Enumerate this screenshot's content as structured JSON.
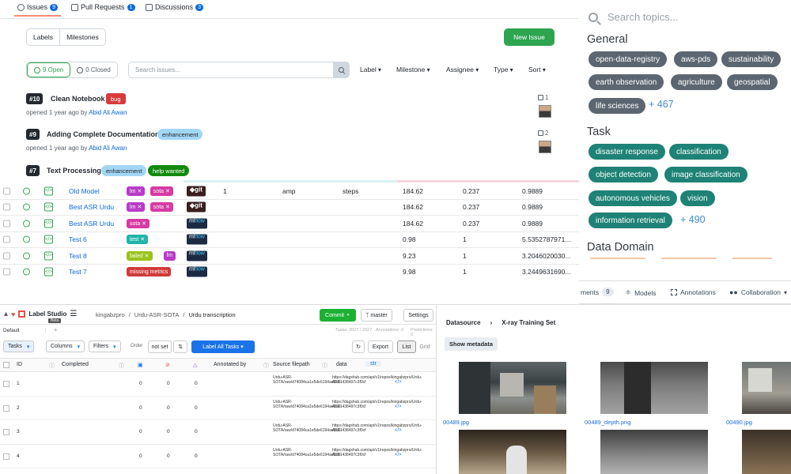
{
  "issues_panel": {
    "tabs": [
      {
        "label": "Issues",
        "count": "9"
      },
      {
        "label": "Pull Requests",
        "count": "1"
      },
      {
        "label": "Discussions",
        "count": "3"
      }
    ],
    "labels_btn": "Labels",
    "milestones_btn": "Milestones",
    "new_issue": "New Issue",
    "open_label": "9 Open",
    "closed_label": "0 Closed",
    "search_placeholder": "Search issues...",
    "filters": [
      "Label",
      "Milestone",
      "Assignee",
      "Type",
      "Sort"
    ],
    "items": [
      {
        "num": "#10",
        "title": "Clean Notebook",
        "labels": [
          {
            "text": "bug",
            "bg": "#d73a3a",
            "fg": "#ffffff"
          }
        ],
        "meta_prefix": "opened 1 year ago by",
        "author": "Abid Ali Awan",
        "comments": "1"
      },
      {
        "num": "#9",
        "title": "Adding Complete Documentation",
        "labels": [
          {
            "text": "enhancement",
            "bg": "#a2eeef",
            "fg": "#1f2328"
          }
        ],
        "meta_prefix": "opened 1 year ago by",
        "author": "Abid Ali Awan",
        "comments": "2"
      },
      {
        "num": "#7",
        "title": "Text Processing",
        "labels": [
          {
            "text": "enhancement",
            "bg": "#a2eeef",
            "fg": "#1f2328"
          },
          {
            "text": "help wanted",
            "bg": "#128a0c",
            "fg": "#ffffff"
          }
        ]
      }
    ]
  },
  "experiments": {
    "rows": [
      {
        "name": "Old Model",
        "tags": [
          {
            "t": "lm ✕",
            "c": "#b83bc7"
          },
          {
            "t": "sota ✕",
            "c": "#d63aa3"
          }
        ],
        "tool": "git",
        "c1": "1",
        "c2": "amp",
        "c3": "steps",
        "v1": "184.62",
        "v2": "0.237",
        "v3": "0.9889"
      },
      {
        "name": "Best ASR Urdu",
        "tags": [
          {
            "t": "lm ✕",
            "c": "#b83bc7"
          },
          {
            "t": "sota ✕",
            "c": "#d63aa3"
          }
        ],
        "tool": "git",
        "c1": "",
        "c2": "",
        "c3": "",
        "v1": "184.62",
        "v2": "0.237",
        "v3": "0.9889"
      },
      {
        "name": "Best ASR Urdu",
        "tags": [
          {
            "t": "sota ✕",
            "c": "#d63aa3"
          }
        ],
        "tool": "mlflow",
        "c1": "",
        "c2": "",
        "c3": "",
        "v1": "184.62",
        "v2": "0.237",
        "v3": "0.9889"
      },
      {
        "name": "Test 6",
        "tags": [
          {
            "t": "test ✕",
            "c": "#20b5a8"
          }
        ],
        "tool": "mlflow",
        "c1": "",
        "c2": "",
        "c3": "",
        "v1": "0.98",
        "v2": "1",
        "v3": "5.5352787971..."
      },
      {
        "name": "Test 8",
        "tags": [
          {
            "t": "failed ✕",
            "c": "#9ac31c"
          },
          {
            "t": "lm",
            "c": "#b83bc7"
          }
        ],
        "tool": "mlflow",
        "c1": "",
        "c2": "",
        "c3": "",
        "v1": "9.23",
        "v2": "1",
        "v3": "3.2046020030..."
      },
      {
        "name": "Test 7",
        "tags": [
          {
            "t": "missing metrics",
            "c": "#d03b3b"
          }
        ],
        "tool": "mlflow",
        "c1": "",
        "c2": "",
        "c3": "",
        "v1": "9.98",
        "v2": "1",
        "v3": "3.2449631690..."
      }
    ],
    "git_label": "git",
    "mlflow_ml": "ml",
    "mlflow_flow": "flow"
  },
  "topics": {
    "search_placeholder": "Search topics...",
    "sections": [
      {
        "title": "General",
        "style": "g",
        "chips": [
          "open-data-registry",
          "aws-pds",
          "sustainability",
          "earth observation",
          "agriculture",
          "geospatial",
          "life sciences"
        ],
        "more": "+ 467"
      },
      {
        "title": "Task",
        "style": "t",
        "chips": [
          "disaster response",
          "classification",
          "object detection",
          "image classification",
          "autonomous vehicles",
          "vision",
          "information retrieval"
        ],
        "more": "+ 490"
      },
      {
        "title": "Data Domain"
      }
    ]
  },
  "model_nav": {
    "items": [
      {
        "label": "ments",
        "count": "9"
      },
      {
        "label": "Models"
      },
      {
        "label": "Annotations"
      },
      {
        "label": "Collaboration"
      }
    ]
  },
  "label_studio": {
    "app_name": "Label Studio",
    "beta": "Beta",
    "breadcrumb": [
      "kingabzpro",
      "Urdu-ASR-SOTA",
      "Urdu transcription"
    ],
    "commit": "Commit",
    "branch": "master",
    "settings": "Settings",
    "tab_default": "Default",
    "tasks_info": "Tasks: 2027 / 2027",
    "annotations_info": "Annotations: 0",
    "predictions_info": "Predictions: 0",
    "toolbar": {
      "tasks": "Tasks",
      "columns": "Columns",
      "filters": "Filters",
      "order": "Order",
      "not_set": "not set",
      "label_all": "Label All Tasks",
      "export": "Export",
      "list": "List",
      "grid": "Grid"
    },
    "columns": [
      "ID",
      "Completed",
      "Annotated by",
      "Source filepath",
      "data",
      "str"
    ],
    "rows": [
      {
        "id": "1",
        "a": "0",
        "b": "0",
        "c": "0",
        "src": "Urdu-ASR-SOTA/raw/d74084ca1e5de6194ae5c61438497c3f0cf",
        "url": "https://dagshub.com/api/v1/repos/kingabzpro/Urdu-ASR-"
      },
      {
        "id": "2",
        "a": "0",
        "b": "0",
        "c": "0",
        "src": "Urdu-ASR-SOTA/raw/d74084ca1e5de6194ae5c61438497c3f0cf",
        "url": "https://dagshub.com/api/v1/repos/kingabzpro/Urdu-ASR-"
      },
      {
        "id": "3",
        "a": "0",
        "b": "0",
        "c": "0",
        "src": "Urdu-ASR-SOTA/raw/d74084ca1e5de6194ae5c61438497c3f0cf",
        "url": "https://dagshub.com/api/v1/repos/kingabzpro/Urdu-ASR-"
      },
      {
        "id": "4",
        "a": "0",
        "b": "0",
        "c": "0",
        "src": "Urdu-ASR-SOTA/raw/d74084ca1e5de6194ae5c61438497c3f0cf",
        "url": "https://dagshub.com/api/v1/repos/kingabzpro/Urdu-ASR-"
      }
    ],
    "code_glyph": "</>"
  },
  "datasource": {
    "crumb_root": "Datasource",
    "crumb_leaf": "X-ray Training Set",
    "show_metadata": "Show metadata",
    "files": [
      "00489.jpg",
      "00489_depth.png",
      "00490.jpg"
    ]
  }
}
